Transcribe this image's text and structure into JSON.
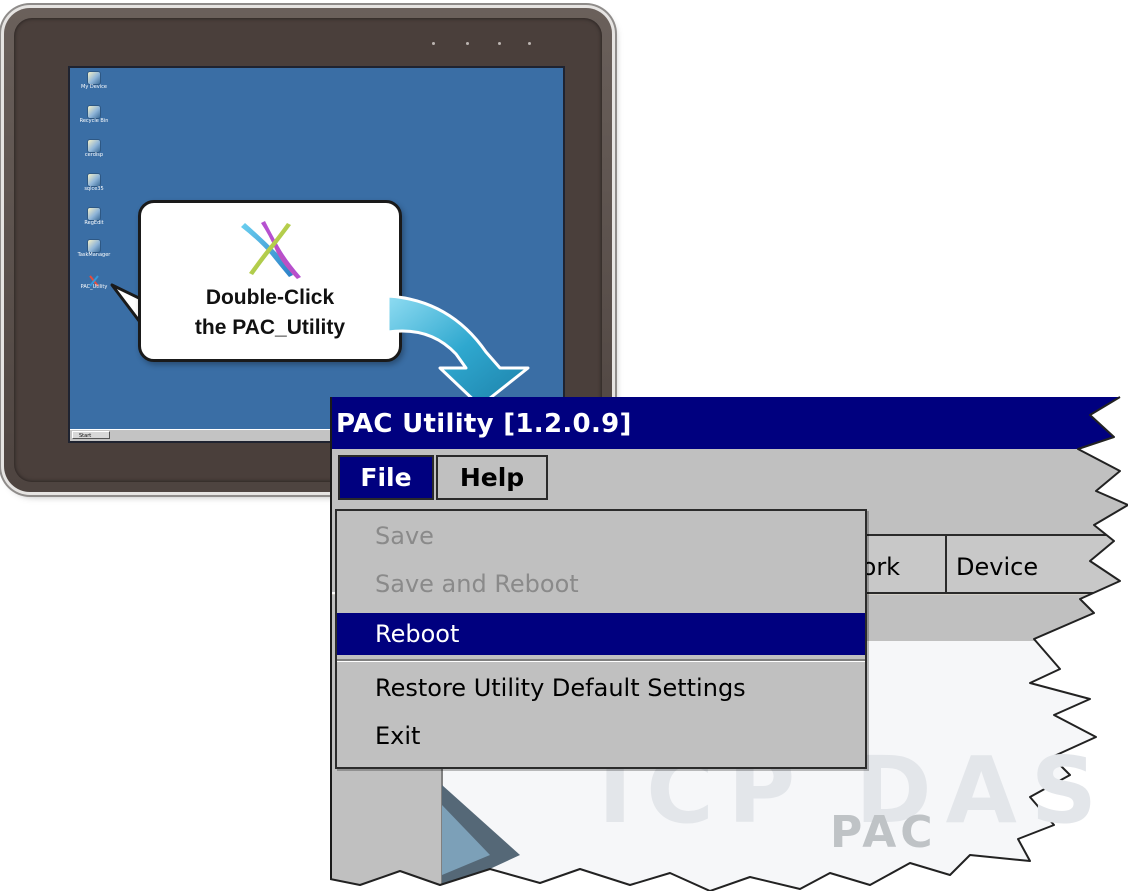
{
  "desktop": {
    "icons": [
      {
        "label": "My Device"
      },
      {
        "label": "Recycle Bin"
      },
      {
        "label": "cerdisp"
      },
      {
        "label": "sqlce35"
      },
      {
        "label": "RegEdit"
      },
      {
        "label": "TaskManager"
      },
      {
        "label": "PAC_Utility"
      }
    ],
    "start_label": "Start"
  },
  "callout": {
    "line1": "Double-Click",
    "line2": "the PAC_Utility"
  },
  "pac_utility": {
    "title": "PAC Utility  [1.2.0.9]",
    "menu": {
      "file": "File",
      "help": "Help"
    },
    "file_menu_items": {
      "save": "Save",
      "save_and_reboot": "Save and Reboot",
      "reboot": "Reboot",
      "restore": "Restore Utility Default Settings",
      "exit": "Exit"
    },
    "tabs": {
      "network_partial": "work",
      "device_partial": "Device"
    },
    "watermark": "ICP DAS",
    "watermark_sub": "PAC"
  },
  "colors": {
    "title_bar": "#00007f",
    "menu_selected": "#00007f",
    "menu_bg": "#c0c0c0",
    "desktop_bg": "#3a6ea5",
    "arrow": "#2fa8cf"
  }
}
